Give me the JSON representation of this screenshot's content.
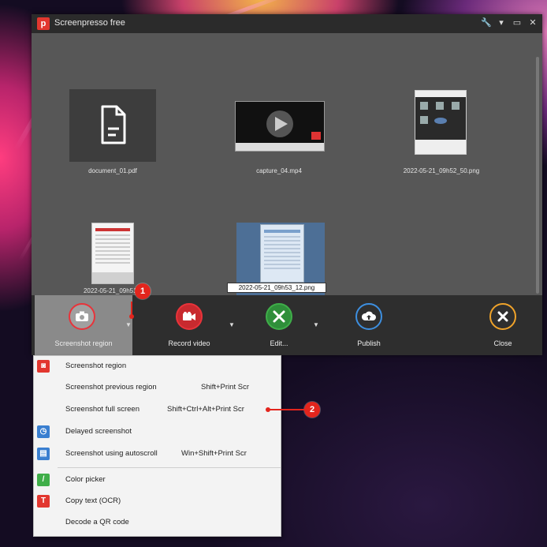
{
  "window": {
    "title": "Screenpresso free",
    "logo_letter": "p",
    "controls": [
      "🔧",
      "▾",
      "▭",
      "✕"
    ]
  },
  "gallery": {
    "items": [
      {
        "caption": "document_01.pdf",
        "kind": "pdf"
      },
      {
        "caption": "capture_04.mp4",
        "kind": "video"
      },
      {
        "caption": "2022-05-21_09h52_50.png",
        "kind": "screenshot"
      },
      {
        "caption": "2022-05-21_09h51_",
        "kind": "screenshot"
      },
      {
        "caption": "2022-05-21_09h53_12.png",
        "kind": "screenshot",
        "selected": true
      }
    ]
  },
  "toolbar": {
    "buttons": [
      {
        "label": "Screenshot region",
        "icon": "camera-icon",
        "color": "#e8333a",
        "active": true
      },
      {
        "label": "Record video",
        "icon": "video-camera-icon",
        "color": "#e8333a"
      },
      {
        "label": "Edit...",
        "icon": "tools-icon",
        "color": "#3fae49"
      },
      {
        "label": "Publish",
        "icon": "cloud-upload-icon",
        "color": "#3d8fe0"
      },
      {
        "label": "Close",
        "icon": "close-icon",
        "color": "#f0a32a"
      }
    ]
  },
  "menu": {
    "items": [
      {
        "label": "Screenshot region",
        "shortcut": "",
        "icon": "camera-icon",
        "color": "#e2372f"
      },
      {
        "label": "Screenshot previous region",
        "shortcut": "Shift+Print Scr",
        "icon": "",
        "color": ""
      },
      {
        "label": "Screenshot full screen",
        "shortcut": "Shift+Ctrl+Alt+Print Scr",
        "icon": "",
        "color": ""
      },
      {
        "label": "Delayed screenshot",
        "shortcut": "",
        "icon": "timer-icon",
        "color": "#3a7fd0"
      },
      {
        "label": "Screenshot using autoscroll",
        "shortcut": "Win+Shift+Print Scr",
        "icon": "autoscroll-icon",
        "color": "#3a7fd0"
      },
      {
        "label": "Color picker",
        "shortcut": "",
        "icon": "eyedropper-icon",
        "color": "#3fae49"
      },
      {
        "label": "Copy text (OCR)",
        "shortcut": "",
        "icon": "text-icon",
        "color": "#e2372f"
      },
      {
        "label": "Decode a QR code",
        "shortcut": "",
        "icon": "",
        "color": ""
      }
    ]
  },
  "annotations": {
    "badge1": "1",
    "badge2": "2"
  }
}
